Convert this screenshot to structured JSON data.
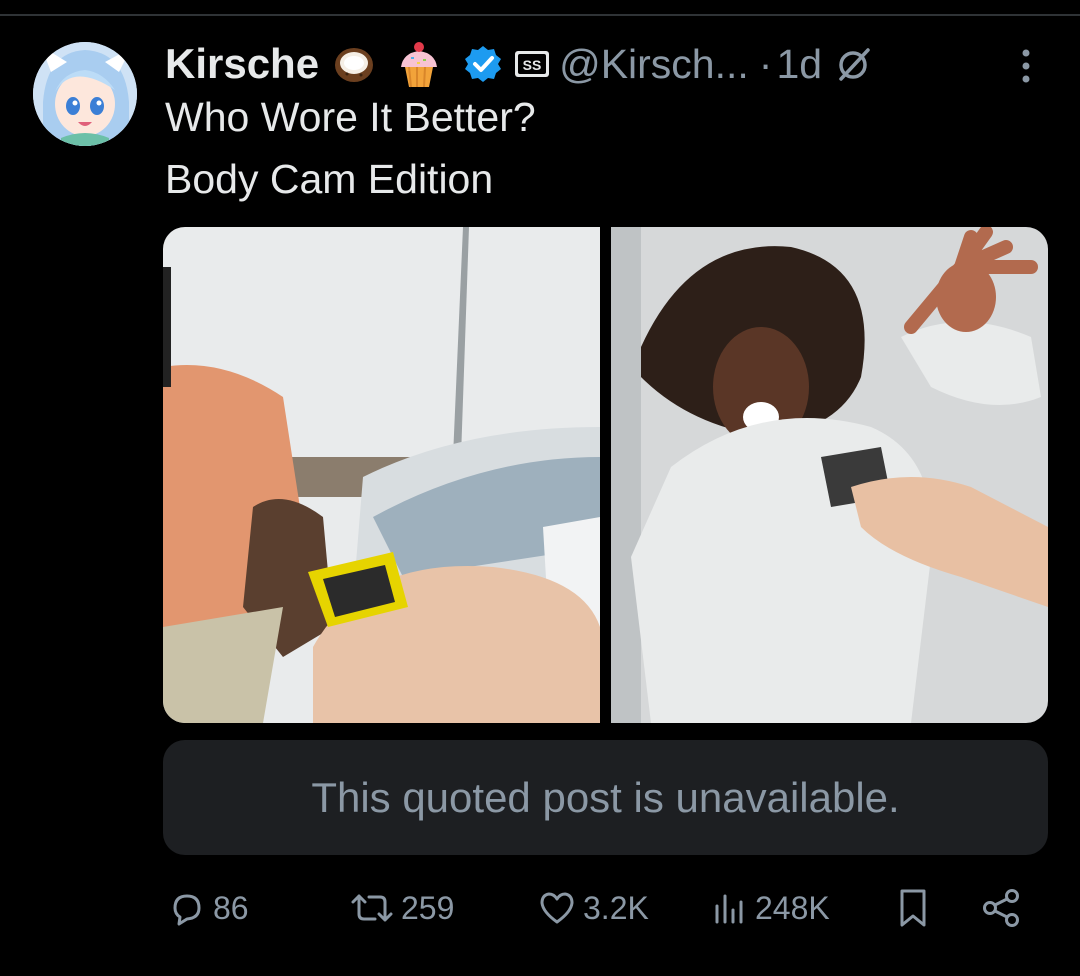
{
  "post": {
    "display_name": "Kirsche",
    "handle": "@Kirsch...",
    "separator": "·",
    "age": "1d",
    "text_line1": "Who Wore It Better?",
    "text_line2": "Body Cam Edition",
    "icons": [
      "coconut-emoji",
      "cupcake-emoji",
      "verified-badge-icon",
      "affiliate-badge-icon",
      "grok-icon",
      "more-options-icon"
    ],
    "accent_color": "#1d9bf0"
  },
  "media": {
    "left_image_alt": "Body cam still: officer holding taser toward man in orange shirt near white car",
    "right_image_alt": "Body cam still: woman in white robe yelling with hand raised"
  },
  "quote": {
    "text": "This quoted post is unavailable."
  },
  "actions": {
    "replies": "86",
    "reposts": "259",
    "likes": "3.2K",
    "views": "248K",
    "icons": [
      "reply-icon",
      "repost-icon",
      "like-icon",
      "views-icon",
      "bookmark-icon",
      "share-icon"
    ]
  }
}
